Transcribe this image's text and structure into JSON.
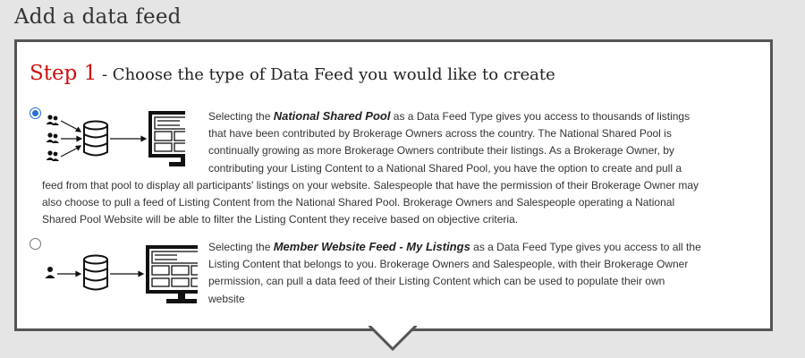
{
  "page": {
    "title": "Add a data feed"
  },
  "step": {
    "number_label": "Step 1",
    "description": " - Choose the type of Data Feed you would like to create"
  },
  "options": [
    {
      "selected": true,
      "lead": "Selecting the ",
      "highlight": "National Shared Pool",
      "lines": [
        " as a Data Feed Type gives you access to thousands of listings",
        "that have been contributed by Brokerage Owners across the country. The National Shared Pool is",
        "continually growing as more Brokerage Owners contribute their listings. As a Brokerage Owner, by",
        "contributing your Listing Content to a National Shared Pool, you have the option to create and pull a",
        "feed from that pool to display all participants' listings on your website. Salespeople that have the permission of their Brokerage Owner may",
        "also choose to pull a feed of Listing Content from the National Shared Pool. Brokerage Owners and Salespeople operating a National",
        "Shared Pool Website will be able to filter the Listing Content they receive based on objective criteria."
      ]
    },
    {
      "selected": false,
      "lead": "Selecting the ",
      "highlight": "Member Website Feed - My Listings",
      "lines": [
        " as a Data Feed Type gives you access to all the",
        "Listing Content that belongs to you. Brokerage Owners and Salespeople, with their Brokerage Owner",
        "permission, can pull a data feed of their Listing Content which can be used to populate their own",
        "website"
      ]
    }
  ],
  "icons": {
    "group_users": "users-icon",
    "single_user": "user-icon",
    "database": "database-icon",
    "monitor": "monitor-icon",
    "arrow": "arrow-right-icon"
  },
  "colors": {
    "accent_red": "#cc1111",
    "radio_blue": "#2a6fd6",
    "border": "#555555"
  }
}
